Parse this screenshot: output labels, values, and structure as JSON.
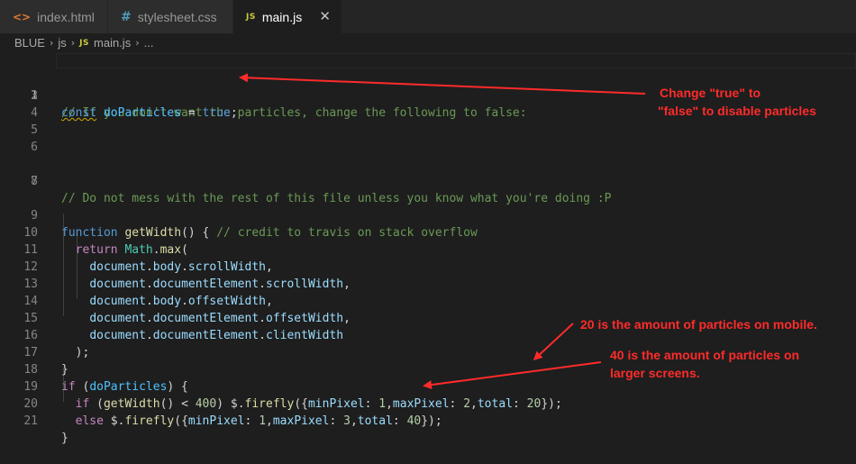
{
  "tabs": [
    {
      "icon": "html-file-icon",
      "label": "index.html",
      "active": false
    },
    {
      "icon": "css-file-icon",
      "label": "stylesheet.css",
      "active": false
    },
    {
      "icon": "js-file-icon",
      "label": "main.js",
      "active": true
    }
  ],
  "tab_icon_glyphs": {
    "html": "<>",
    "css": "#",
    "js": "JS"
  },
  "close_glyph": "✕",
  "breadcrumb": {
    "root": "BLUE",
    "folder": "js",
    "file": "main.js",
    "tail": "..."
  },
  "line_numbers": [
    "1",
    "2",
    "3",
    "4",
    "5",
    "6",
    "7",
    "8",
    "9",
    "10",
    "11",
    "12",
    "13",
    "14",
    "15",
    "16",
    "17",
    "18",
    "19",
    "20",
    "21"
  ],
  "code": {
    "l1": "// If you don't want the particles, change the following to false:",
    "l2": {
      "kw": "const",
      "var": "doParticles",
      "op": " = ",
      "val": "true",
      "end": ";"
    },
    "l7": "// Do not mess with the rest of this file unless you know what you're doing :P",
    "l9": {
      "kw": "function",
      "fn": "getWidth",
      "punc": "() { ",
      "comment": "// credit to travis on stack overflow"
    },
    "l10": {
      "kw": "return",
      "cls": "Math",
      "fn": "max",
      "punc": "("
    },
    "l11": {
      "obj": "document",
      "p1": "body",
      "p2": "scrollWidth",
      "end": ","
    },
    "l12": {
      "obj": "document",
      "p1": "documentElement",
      "p2": "scrollWidth",
      "end": ","
    },
    "l13": {
      "obj": "document",
      "p1": "body",
      "p2": "offsetWidth",
      "end": ","
    },
    "l14": {
      "obj": "document",
      "p1": "documentElement",
      "p2": "offsetWidth",
      "end": ","
    },
    "l15": {
      "obj": "document",
      "p1": "documentElement",
      "p2": "clientWidth",
      "end": ""
    },
    "l16": ");",
    "l17": "}",
    "l18": {
      "kw": "if",
      "punc1": " (",
      "var": "doParticles",
      "punc2": ") {"
    },
    "l19": {
      "kw": "if",
      "fn": "getWidth",
      "num1": "400",
      "fn2": "firefly",
      "p1": "minPixel",
      "n1": "1",
      "p2": "maxPixel",
      "n2": "2",
      "p3": "total",
      "n3": "20"
    },
    "l20": {
      "kw": "else",
      "fn2": "firefly",
      "p1": "minPixel",
      "n1": "1",
      "p2": "maxPixel",
      "n2": "3",
      "p3": "total",
      "n3": "40"
    },
    "l21": "}"
  },
  "annotations": {
    "a1_line1": "Change \"true\" to",
    "a1_line2": "\"false\" to disable particles",
    "a2": "20 is the amount of particles on mobile.",
    "a3_line1": "40 is the amount of particles on",
    "a3_line2": "larger screens."
  },
  "colors": {
    "annotation": "#ff2b2b",
    "editor_bg": "#1e1e1e"
  }
}
